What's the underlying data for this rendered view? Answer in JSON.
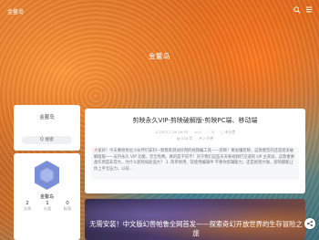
{
  "site": {
    "logo_text": "金鳌岛",
    "hero_title": "金鳌岛"
  },
  "sidebar": {
    "blog_name": "金鳌岛",
    "search_label": "Q 搜索"
  },
  "profile": {
    "name": "金鳌岛",
    "stats": [
      {
        "value": "2",
        "label": "文章"
      },
      {
        "value": "1",
        "label": "分类"
      },
      {
        "value": "0",
        "label": "标签"
      }
    ]
  },
  "posts": [
    {
      "title": "剪映永久VIP-剪映破解版-剪映PC端、移动端",
      "date": "2023-7-26 16:35",
      "comments": "0",
      "likes": "0",
      "category": "未分类",
      "words": "518 字",
      "read_time": "2 分钟",
      "excerpt": "大家好！今天要给各位小伙伴们安利一款我来测试好用的视频编工具——剪映！要说懂剪映，这款重型的还是挺多破解版版——支持永久 VIP 功能，完全免费。真的是干货不！对于我们这些天天和视频打交道的 UP 主来说，这款重要类作用是非常大。为什么剪映如此强大？ 1. 简单易用、软使用编辑手 不要你剪辑能力，还是视频大咖，剪映都能让你上手无压力。以前..."
    },
    {
      "title": "无需安装！中文版幻兽帕鲁全网首发——探索奇幻开放世界的生存冒险之旅"
    }
  ],
  "colors": {
    "accent": "#3f6fb6",
    "hexagon": "#7b8fd8"
  }
}
